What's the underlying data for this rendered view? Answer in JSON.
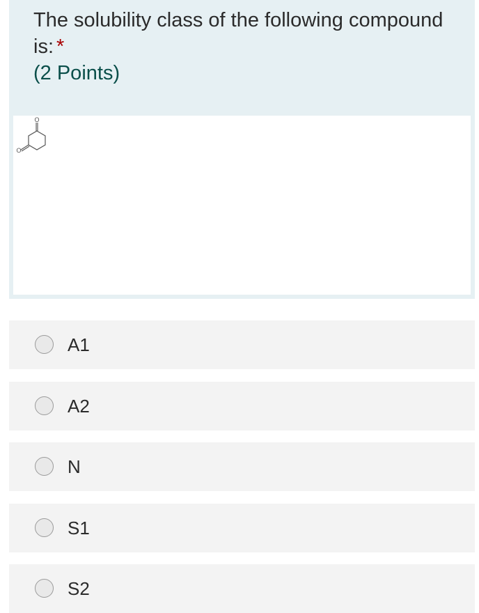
{
  "question": {
    "title": "The solubility class of the following compound is:",
    "required_marker": "*",
    "points": "(2 Points)",
    "image": {
      "kind": "chemical-structure",
      "atom_labels": [
        "O",
        "O"
      ]
    }
  },
  "options": [
    {
      "label": "A1",
      "selected": false
    },
    {
      "label": "A2",
      "selected": false
    },
    {
      "label": "N",
      "selected": false
    },
    {
      "label": "S1",
      "selected": false
    },
    {
      "label": "S2",
      "selected": false
    }
  ],
  "colors": {
    "question_background": "#e6f0f3",
    "option_background": "#f3f3f3",
    "required": "#a80000",
    "points": "#0b4f4a"
  }
}
